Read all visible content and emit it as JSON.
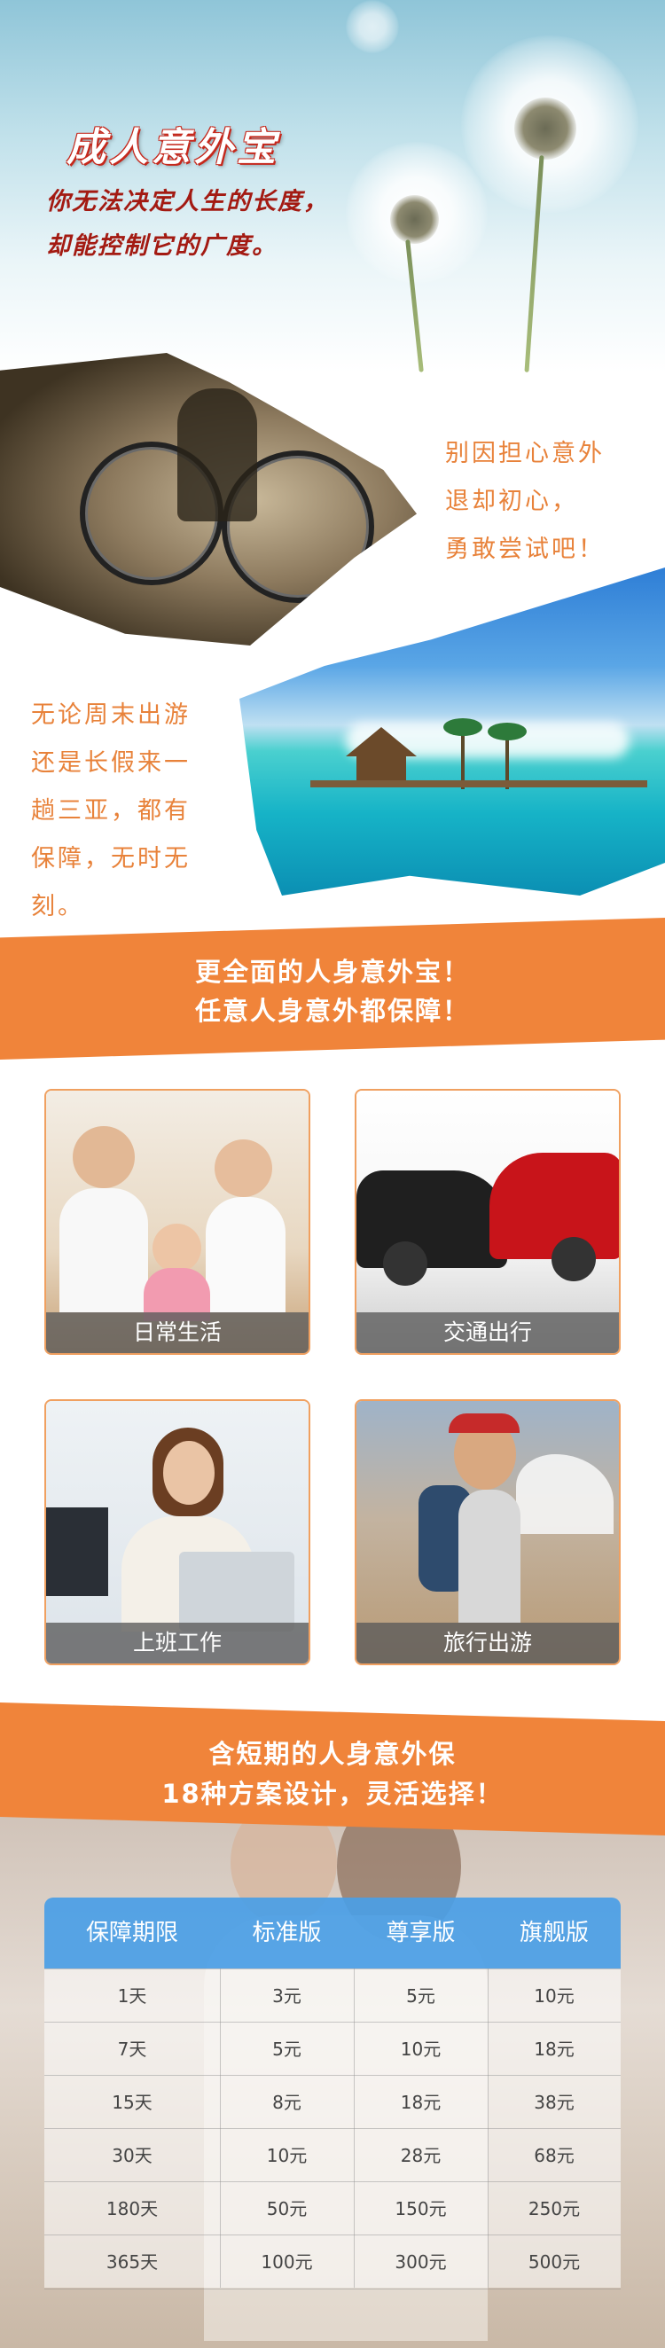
{
  "hero": {
    "title": "成人意外宝",
    "subtitle_line1": "你无法决定人生的长度，",
    "subtitle_line2": "却能控制它的广度。"
  },
  "section_bike": {
    "text": [
      "别因担心意外",
      "退却初心，",
      "勇敢尝试吧！"
    ]
  },
  "section_beach": {
    "text": [
      "无论周末出游",
      "还是长假来一",
      "趟三亚，都有",
      "保障，无时无",
      "刻。"
    ]
  },
  "banner1": {
    "line1": "更全面的人身意外宝！",
    "line2": "任意人身意外都保障！"
  },
  "cards": [
    {
      "label": "日常生活"
    },
    {
      "label": "交通出行"
    },
    {
      "label": "上班工作"
    },
    {
      "label": "旅行出游"
    }
  ],
  "banner2": {
    "line1": "含短期的人身意外保",
    "line2": "18种方案设计，灵活选择！"
  },
  "table": {
    "headers": [
      "保障期限",
      "标准版",
      "尊享版",
      "旗舰版"
    ],
    "rows": [
      [
        "1天",
        "3元",
        "5元",
        "10元"
      ],
      [
        "7天",
        "5元",
        "10元",
        "18元"
      ],
      [
        "15天",
        "8元",
        "18元",
        "38元"
      ],
      [
        "30天",
        "10元",
        "28元",
        "68元"
      ],
      [
        "180天",
        "50元",
        "150元",
        "250元"
      ],
      [
        "365天",
        "100元",
        "300元",
        "500元"
      ]
    ]
  },
  "colors": {
    "accent_orange": "#f0843a",
    "title_red": "#a31a12",
    "table_header_blue": "#4a9ee6"
  }
}
